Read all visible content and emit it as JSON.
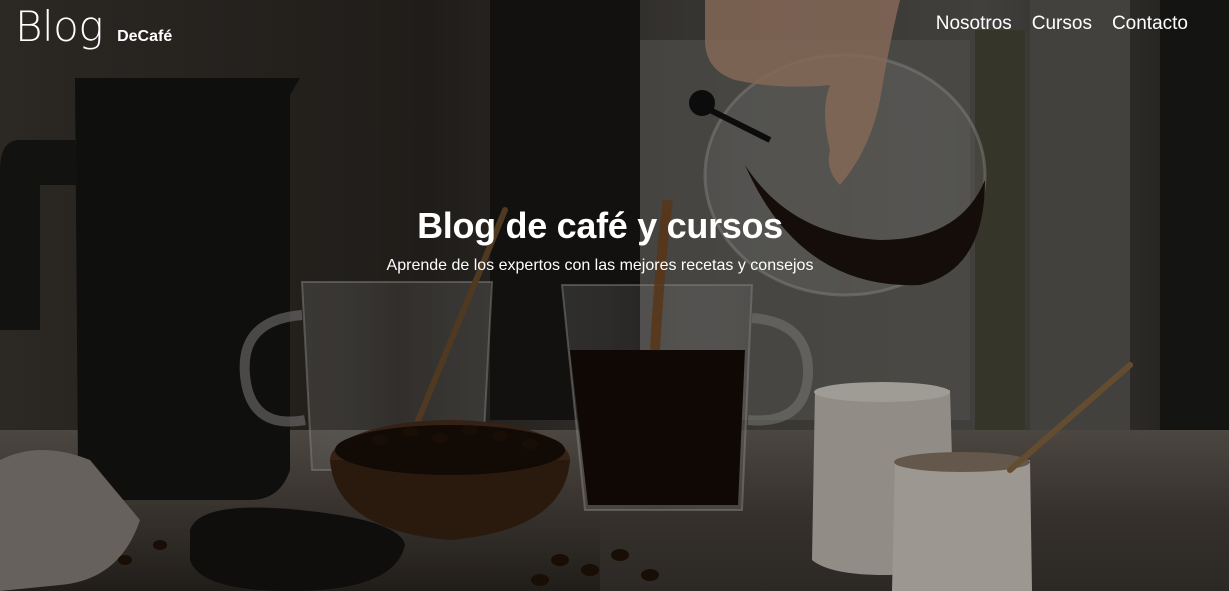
{
  "header": {
    "logo_main": "Blog",
    "logo_sub": "DeCafé"
  },
  "nav": {
    "items": [
      {
        "label": "Nosotros"
      },
      {
        "label": "Cursos"
      },
      {
        "label": "Contacto"
      }
    ]
  },
  "hero": {
    "title": "Blog de café y cursos",
    "subtitle": "Aprende de los expertos con las mejores recetas y consejos"
  },
  "colors": {
    "text": "#ffffff",
    "overlay": "#000000",
    "background": "#1e1a17"
  }
}
